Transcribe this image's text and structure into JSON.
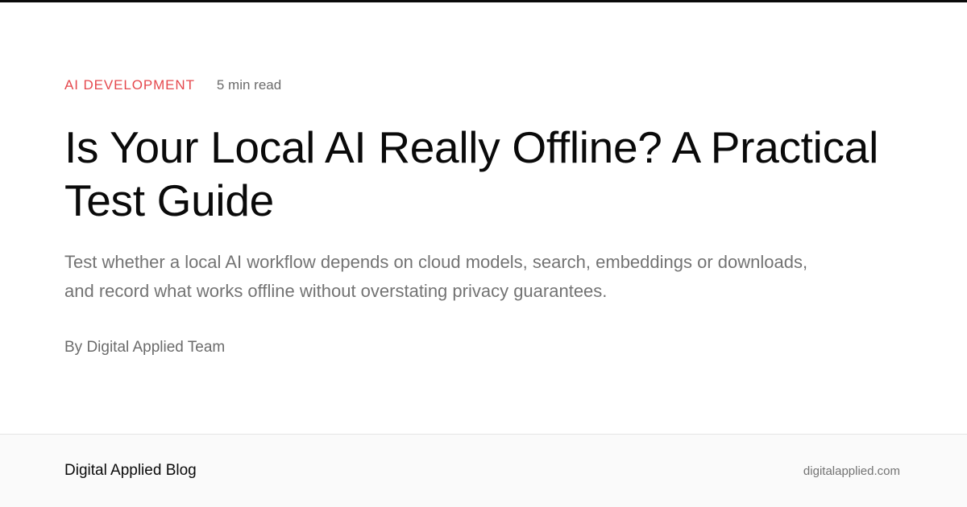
{
  "article": {
    "category": "AI DEVELOPMENT",
    "read_time": "5 min read",
    "title": "Is Your Local AI Really Offline? A Practical Test Guide",
    "description": "Test whether a local AI workflow depends on cloud models, search, embeddings or downloads, and record what works offline without overstating privacy guarantees.",
    "author": "By Digital Applied Team"
  },
  "footer": {
    "brand": "Digital Applied Blog",
    "domain": "digitalapplied.com"
  },
  "colors": {
    "accent": "#e5484d",
    "text_primary": "#0a0a0a",
    "text_muted": "#737373",
    "footer_bg": "#fafafa"
  }
}
